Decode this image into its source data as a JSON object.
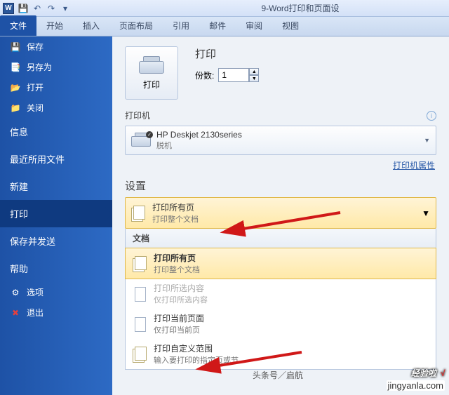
{
  "titlebar": {
    "doc_title": "9-Word打印和页面设"
  },
  "ribbon": {
    "tabs": [
      "文件",
      "开始",
      "插入",
      "页面布局",
      "引用",
      "邮件",
      "审阅",
      "视图"
    ],
    "active": 0
  },
  "sidebar": {
    "quick": [
      {
        "icon": "save-icon",
        "label": "保存"
      },
      {
        "icon": "saveas-icon",
        "label": "另存为"
      },
      {
        "icon": "open-icon",
        "label": "打开"
      },
      {
        "icon": "close-icon",
        "label": "关闭"
      }
    ],
    "sections": [
      "信息",
      "最近所用文件",
      "新建",
      "打印",
      "保存并发送",
      "帮助"
    ],
    "active_section": "打印",
    "bottom": [
      {
        "icon": "options-icon",
        "label": "选项"
      },
      {
        "icon": "exit-icon",
        "label": "退出"
      }
    ]
  },
  "print": {
    "button_label": "打印",
    "section_label": "打印",
    "copies_label": "份数:",
    "copies_value": "1"
  },
  "printer": {
    "heading": "打印机",
    "name": "HP Deskjet 2130series",
    "status": "脱机",
    "props_link": "打印机属性"
  },
  "settings": {
    "heading": "设置",
    "selected": {
      "title": "打印所有页",
      "sub": "打印整个文档"
    },
    "menu_header": "文档",
    "items": [
      {
        "title": "打印所有页",
        "sub": "打印整个文档",
        "selected": true
      },
      {
        "title": "打印所选内容",
        "sub": "仅打印所选内容",
        "disabled": true
      },
      {
        "title": "打印当前页面",
        "sub": "仅打印当前页"
      },
      {
        "title": "打印自定义范围",
        "sub": "输入要打印的指定页或节"
      }
    ]
  },
  "watermark": {
    "big": "经验啦",
    "check": "√",
    "footer": "头条号／启航",
    "site": "jingyanla.com"
  }
}
